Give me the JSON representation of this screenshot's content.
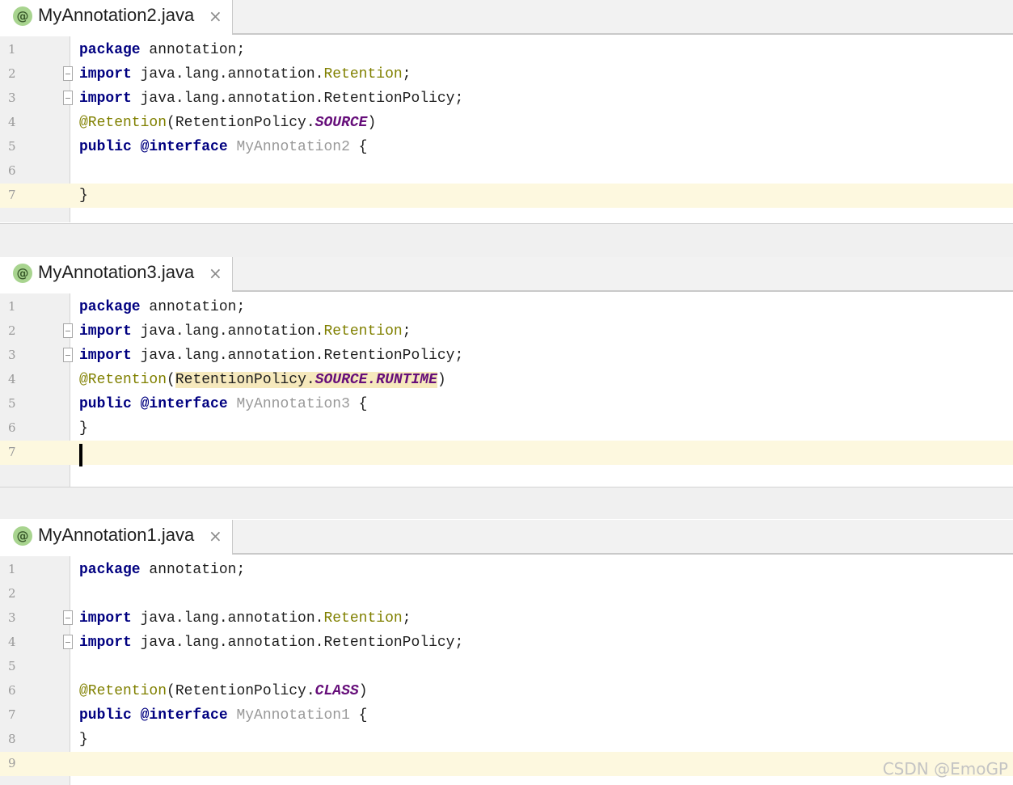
{
  "panels": [
    {
      "tab": {
        "icon": "@",
        "label": "MyAnnotation2.java",
        "close": "×"
      },
      "lines": [
        {
          "n": "1",
          "fold": false,
          "current": false,
          "tokens": [
            [
              "kw",
              "package"
            ],
            [
              "cls",
              " annotation;"
            ]
          ]
        },
        {
          "n": "2",
          "fold": true,
          "current": false,
          "tokens": [
            [
              "kw",
              "import"
            ],
            [
              "cls",
              " java.lang.annotation."
            ],
            [
              "ann",
              "Retention"
            ],
            [
              "cls",
              ";"
            ]
          ]
        },
        {
          "n": "3",
          "fold": true,
          "current": false,
          "tokens": [
            [
              "kw",
              "import"
            ],
            [
              "cls",
              " java.lang.annotation.RetentionPolicy;"
            ]
          ]
        },
        {
          "n": "4",
          "fold": false,
          "current": false,
          "tokens": [
            [
              "ann",
              "@Retention"
            ],
            [
              "cls",
              "(RetentionPolicy."
            ],
            [
              "const",
              "SOURCE"
            ],
            [
              "cls",
              ")"
            ]
          ]
        },
        {
          "n": "5",
          "fold": false,
          "current": false,
          "tokens": [
            [
              "kw",
              "public @interface"
            ],
            [
              "dim",
              " MyAnnotation2"
            ],
            [
              "cls",
              " {"
            ]
          ]
        },
        {
          "n": "6",
          "fold": false,
          "current": false,
          "tokens": []
        },
        {
          "n": "7",
          "fold": false,
          "current": true,
          "tokens": [
            [
              "cls",
              "}"
            ]
          ]
        }
      ]
    },
    {
      "tab": {
        "icon": "@",
        "label": "MyAnnotation3.java",
        "close": "×"
      },
      "lines": [
        {
          "n": "1",
          "fold": false,
          "current": false,
          "tokens": [
            [
              "kw",
              "package"
            ],
            [
              "cls",
              " annotation;"
            ]
          ]
        },
        {
          "n": "2",
          "fold": true,
          "current": false,
          "tokens": [
            [
              "kw",
              "import"
            ],
            [
              "cls",
              " java.lang.annotation."
            ],
            [
              "ann",
              "Retention"
            ],
            [
              "cls",
              ";"
            ]
          ]
        },
        {
          "n": "3",
          "fold": true,
          "current": false,
          "tokens": [
            [
              "kw",
              "import"
            ],
            [
              "cls",
              " java.lang.annotation.RetentionPolicy;"
            ]
          ]
        },
        {
          "n": "4",
          "fold": false,
          "current": false,
          "tokens": [
            [
              "ann",
              "@Retention"
            ],
            [
              "cls",
              "("
            ],
            [
              "hl-cls",
              "RetentionPolicy."
            ],
            [
              "hl-const",
              "SOURCE.RUNTIME"
            ],
            [
              "cls",
              ")"
            ]
          ]
        },
        {
          "n": "5",
          "fold": false,
          "current": false,
          "tokens": [
            [
              "kw",
              "public @interface"
            ],
            [
              "dim",
              " MyAnnotation3"
            ],
            [
              "cls",
              " {"
            ]
          ]
        },
        {
          "n": "6",
          "fold": false,
          "current": false,
          "tokens": [
            [
              "cls",
              "}"
            ]
          ]
        },
        {
          "n": "7",
          "fold": false,
          "current": true,
          "caret": true,
          "tokens": []
        }
      ]
    },
    {
      "tab": {
        "icon": "@",
        "label": "MyAnnotation1.java",
        "close": "×"
      },
      "lines": [
        {
          "n": "1",
          "fold": false,
          "current": false,
          "tokens": [
            [
              "kw",
              "package"
            ],
            [
              "cls",
              " annotation;"
            ]
          ]
        },
        {
          "n": "2",
          "fold": false,
          "current": false,
          "tokens": []
        },
        {
          "n": "3",
          "fold": true,
          "current": false,
          "tokens": [
            [
              "kw",
              "import"
            ],
            [
              "cls",
              " java.lang.annotation."
            ],
            [
              "ann",
              "Retention"
            ],
            [
              "cls",
              ";"
            ]
          ]
        },
        {
          "n": "4",
          "fold": true,
          "current": false,
          "tokens": [
            [
              "kw",
              "import"
            ],
            [
              "cls",
              " java.lang.annotation.RetentionPolicy;"
            ]
          ]
        },
        {
          "n": "5",
          "fold": false,
          "current": false,
          "tokens": []
        },
        {
          "n": "6",
          "fold": false,
          "current": false,
          "tokens": [
            [
              "ann",
              "@Retention"
            ],
            [
              "cls",
              "(RetentionPolicy."
            ],
            [
              "const",
              "CLASS"
            ],
            [
              "cls",
              ")"
            ]
          ]
        },
        {
          "n": "7",
          "fold": false,
          "current": false,
          "tokens": [
            [
              "kw",
              "public @interface"
            ],
            [
              "dim",
              " MyAnnotation1"
            ],
            [
              "cls",
              " {"
            ]
          ]
        },
        {
          "n": "8",
          "fold": false,
          "current": false,
          "tokens": [
            [
              "cls",
              "}"
            ]
          ]
        },
        {
          "n": "9",
          "fold": false,
          "current": true,
          "tokens": []
        }
      ]
    }
  ],
  "watermark": "CSDN @EmoGP",
  "colors": {
    "keyword": "#000080",
    "annotation": "#808000",
    "constant": "#660e7a",
    "current_line": "#fdf8df",
    "gutter": "#f0f0f0",
    "tab_icon": "#a8d48f"
  }
}
